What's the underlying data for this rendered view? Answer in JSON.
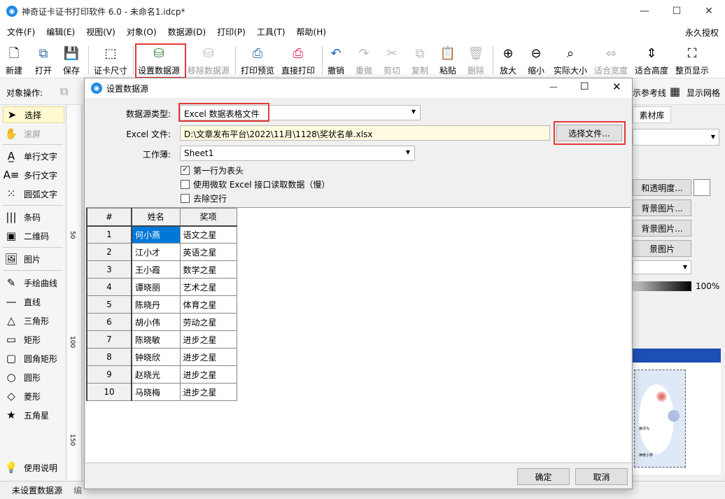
{
  "window": {
    "title": "神奇证卡证书打印软件 6.0 - 未命名1.idcp*",
    "minimize": "—",
    "maximize": "☐",
    "close": "✕"
  },
  "menu": {
    "items": [
      "文件(F)",
      "编辑(E)",
      "视图(V)",
      "对象(O)",
      "数据源(D)",
      "打印(P)",
      "工具(T)",
      "帮助(H)"
    ],
    "license": "永久授权"
  },
  "toolbar": {
    "new": "新建",
    "open": "打开",
    "save": "保存",
    "card_size": "证卡尺寸",
    "set_datasource": "设置数据源",
    "remove_datasource": "移除数据源",
    "print_preview": "打印预览",
    "direct_print": "直接打印",
    "undo": "撤销",
    "redo": "重做",
    "cut": "剪切",
    "copy": "复制",
    "paste": "粘贴",
    "delete": "删除",
    "zoom_in": "放大",
    "zoom_out": "缩小",
    "actual_size": "实际大小",
    "fit_width": "适合宽度",
    "fit_height": "适合高度",
    "full_page": "整页显示"
  },
  "objbar": {
    "label": "对象操作:",
    "ref_lines": "示参考线",
    "show_grid": "显示网格"
  },
  "tools": [
    "选择",
    "滚屏",
    "单行文字",
    "多行文字",
    "圆弧文字",
    "条码",
    "二维码",
    "图片",
    "手绘曲线",
    "直线",
    "三角形",
    "矩形",
    "圆角矩形",
    "圆形",
    "菱形",
    "五角星",
    "使用说明"
  ],
  "ruler": {
    "mark1": "50",
    "mark2": "100",
    "mark3": "150"
  },
  "rightpanel": {
    "tab": "素材库",
    "btn_transparency": "和透明度...",
    "btn_bg1": "背景图片...",
    "btn_bg2": "背景图片...",
    "btn_bg3": "景图片",
    "opacity": "100%",
    "preview_text1": "被评为",
    "preview_text2": "神奇小学"
  },
  "status": {
    "datasource": "未设置数据源",
    "extra": "编"
  },
  "dialog": {
    "title": "设置数据源",
    "ds_type_label": "数据源类型:",
    "ds_type_value": "Excel 数据表格文件",
    "file_label": "Excel 文件:",
    "file_value": "D:\\文章发布平台\\2022\\11月\\1128\\奖状名单.xlsx",
    "choose_file": "选择文件...",
    "sheet_label": "工作薄:",
    "sheet_value": "Sheet1",
    "chk_header": "第一行为表头",
    "chk_ms_excel": "使用微软 Excel 接口读取数据（慢）",
    "chk_remove_empty": "去除空行",
    "ok": "确定",
    "cancel": "取消",
    "table": {
      "headers": [
        "#",
        "姓名",
        "奖项"
      ],
      "rows": [
        [
          "1",
          "何小燕",
          "语文之星"
        ],
        [
          "2",
          "江小才",
          "英语之星"
        ],
        [
          "3",
          "王小霞",
          "数学之星"
        ],
        [
          "4",
          "谭晓丽",
          "艺术之星"
        ],
        [
          "5",
          "陈晓丹",
          "体育之星"
        ],
        [
          "6",
          "胡小伟",
          "劳动之星"
        ],
        [
          "7",
          "陈晓敏",
          "进步之星"
        ],
        [
          "8",
          "钟晓欣",
          "进步之星"
        ],
        [
          "9",
          "赵晓光",
          "进步之星"
        ],
        [
          "10",
          "马晓梅",
          "进步之星"
        ]
      ]
    }
  }
}
